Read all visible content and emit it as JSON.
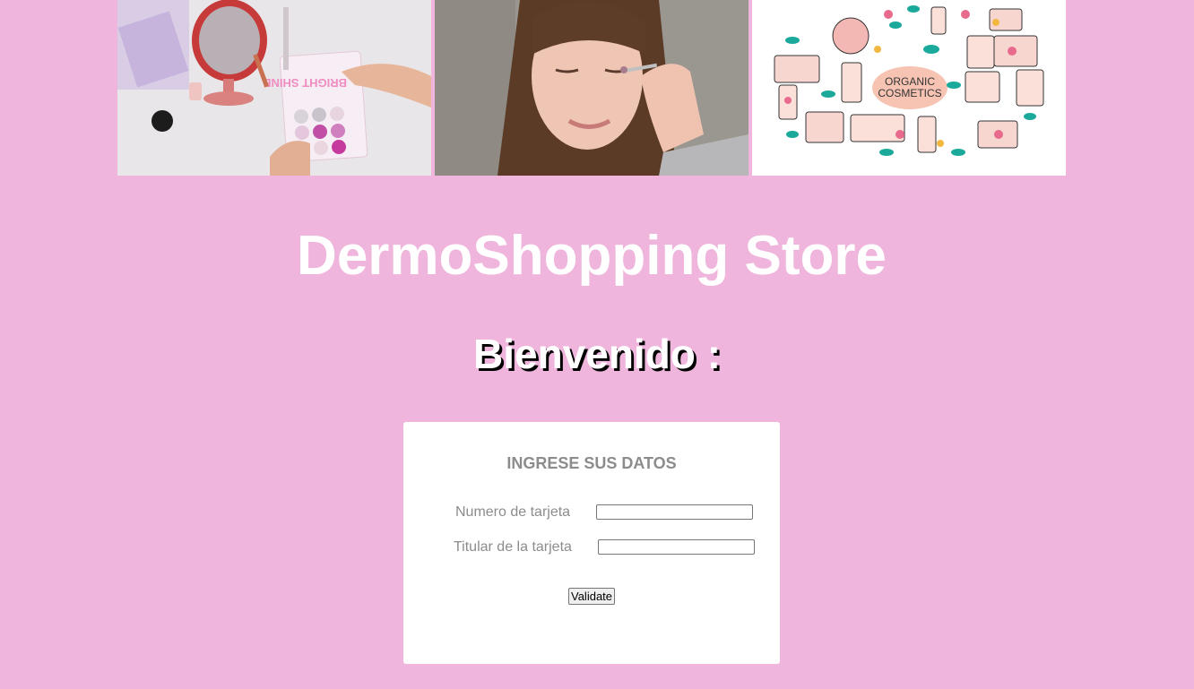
{
  "banner": {
    "image1_text": "BRIGHT SHINE",
    "image3_text_line1": "ORGANIC",
    "image3_text_line2": "COSMETICS"
  },
  "store_title": "DermoShopping Store",
  "welcome_text": "Bienvenido :",
  "form": {
    "title": "INGRESE SUS DATOS",
    "card_number_label": "Numero de tarjeta",
    "card_number_value": "",
    "card_holder_label": "Titular de la tarjeta",
    "card_holder_value": "",
    "submit_label": "Validate"
  },
  "colors": {
    "background": "#f0b5dc",
    "card": "#ffffff",
    "label": "#8c8c8c"
  }
}
